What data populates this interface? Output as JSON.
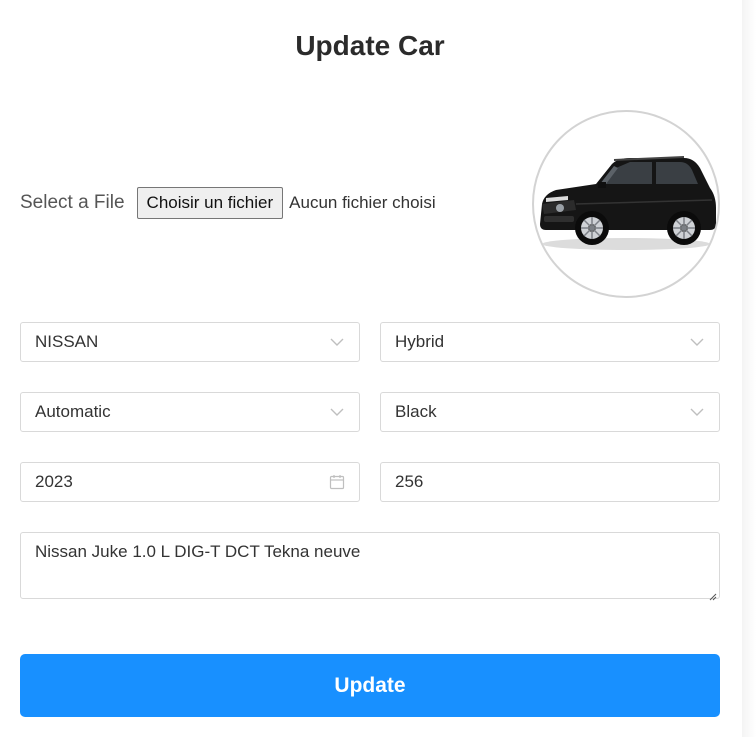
{
  "page": {
    "title": "Update Car"
  },
  "upload": {
    "label": "Select a File",
    "button_label": "Choisir un fichier",
    "status": "Aucun fichier choisi"
  },
  "preview": {
    "icon": "car-photo",
    "car_color": "#111111"
  },
  "form": {
    "brand": {
      "value": "NISSAN",
      "icon": "chevron-down-icon"
    },
    "fuel": {
      "value": "Hybrid",
      "icon": "chevron-down-icon"
    },
    "transmission": {
      "value": "Automatic",
      "icon": "chevron-down-icon"
    },
    "color": {
      "value": "Black",
      "icon": "chevron-down-icon"
    },
    "year": {
      "value": "2023",
      "icon": "calendar-icon"
    },
    "power": {
      "value": "256"
    },
    "description": {
      "value": "Nissan Juke 1.0 L DIG-T DCT Tekna neuve"
    }
  },
  "actions": {
    "update_label": "Update"
  },
  "colors": {
    "accent": "#1890ff",
    "border": "#d9d9d9",
    "text": "#333333"
  }
}
